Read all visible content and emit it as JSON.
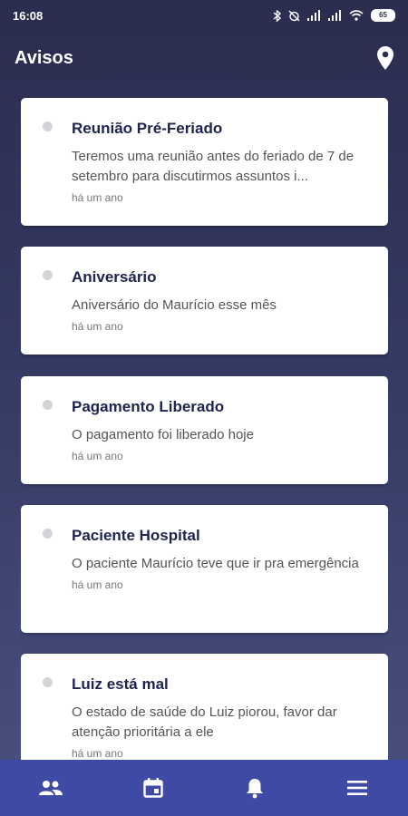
{
  "statusbar": {
    "time": "16:08",
    "battery": "65"
  },
  "header": {
    "title": "Avisos",
    "location_icon": "location-pin-icon"
  },
  "notices": [
    {
      "title": "Reunião Pré-Feriado",
      "text": "Teremos uma reunião antes do feriado de 7 de setembro para discutirmos assuntos i...",
      "time": "há um ano"
    },
    {
      "title": "Aniversário",
      "text": "Aniversário do Maurício esse mês",
      "time": "há um ano"
    },
    {
      "title": "Pagamento Liberado",
      "text": "O pagamento foi liberado hoje",
      "time": "há um ano"
    },
    {
      "title": "Paciente Hospital",
      "text": "O paciente Maurício teve que ir pra emergência",
      "time": "há um ano"
    },
    {
      "title": "Luiz está mal",
      "text": "O estado de saúde do Luiz piorou, favor dar atenção prioritária a ele",
      "time": "há um ano"
    }
  ],
  "bottom_nav": [
    {
      "icon": "people-icon",
      "active": false
    },
    {
      "icon": "calendar-icon",
      "active": false
    },
    {
      "icon": "bell-icon",
      "active": true
    },
    {
      "icon": "menu-icon",
      "active": false
    }
  ],
  "colors": {
    "accent": "#3f4aa5",
    "title": "#1f2350",
    "background_top": "#2b2d4f"
  }
}
